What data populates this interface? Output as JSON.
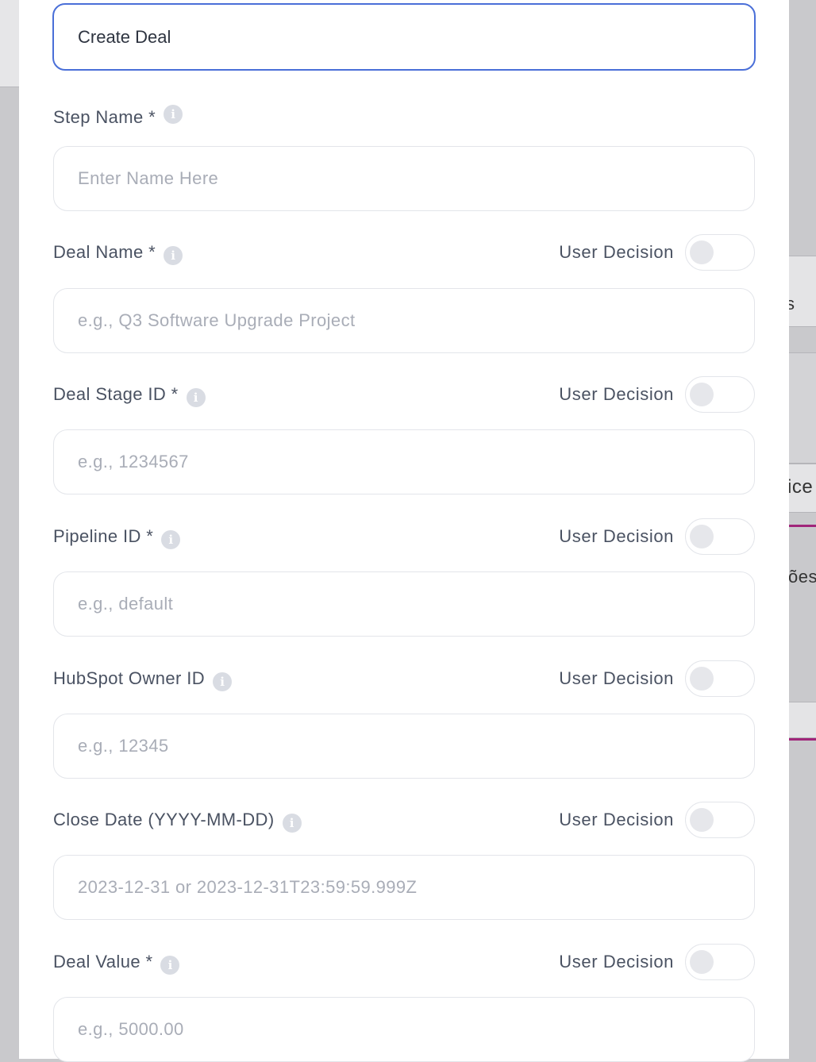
{
  "modal": {
    "title_value": "Create Deal"
  },
  "fields": [
    {
      "label": "Step Name *",
      "placeholder": "Enter Name Here",
      "has_decision": false
    },
    {
      "label": "Deal Name *",
      "placeholder": "e.g., Q3 Software Upgrade Project",
      "has_decision": true
    },
    {
      "label": "Deal Stage ID *",
      "placeholder": "e.g., 1234567",
      "has_decision": true
    },
    {
      "label": "Pipeline ID *",
      "placeholder": "e.g., default",
      "has_decision": true
    },
    {
      "label": "HubSpot Owner ID",
      "placeholder": "e.g., 12345",
      "has_decision": true
    },
    {
      "label": "Close Date (YYYY-MM-DD)",
      "placeholder": "2023-12-31 or 2023-12-31T23:59:59.999Z",
      "has_decision": true
    },
    {
      "label": "Deal Value *",
      "placeholder": "e.g., 5000.00",
      "has_decision": true
    }
  ],
  "decision_label": "User Decision",
  "toggles_on": false,
  "background": {
    "fragments": [
      "s",
      "ice",
      "ões"
    ]
  },
  "colors": {
    "focus_border": "#4a6fd8",
    "accent_pink": "#a0257a"
  },
  "icons": {
    "info": "info-icon"
  }
}
